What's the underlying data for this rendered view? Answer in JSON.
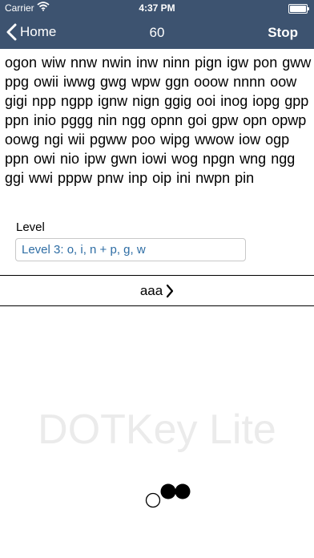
{
  "status_bar": {
    "carrier": "Carrier",
    "time": "4:37 PM",
    "wifi_icon": "wifi-icon",
    "battery_icon": "battery-icon"
  },
  "nav": {
    "back_label": "Home",
    "title": "60",
    "stop_label": "Stop",
    "background_color": "#3d5370"
  },
  "practice_text": "ogon wiw nnw nwin inw ninn pign igw pon gww ppg owii iwwg gwg wpw ggn ooow nnnn oow gigi npp ngpp ignw nign ggig ooi inog iopg gpp ppn inio pggg nin ngg opnn goi gpw opn opwp oowg ngi wii pgww poo wipg wwow iow ogp ppn owi nio ipw gwn iowi wog npgn wng ngg ggi wwi pppw pnw inp oip ini nwpn pin",
  "level": {
    "label": "Level",
    "value": "Level 3: o, i, n + p, g, w",
    "value_color": "#2e6da4"
  },
  "lesson": {
    "label": "aaa"
  },
  "watermark": "DOTKey Lite",
  "dots_icon": "braille-dots-icon"
}
